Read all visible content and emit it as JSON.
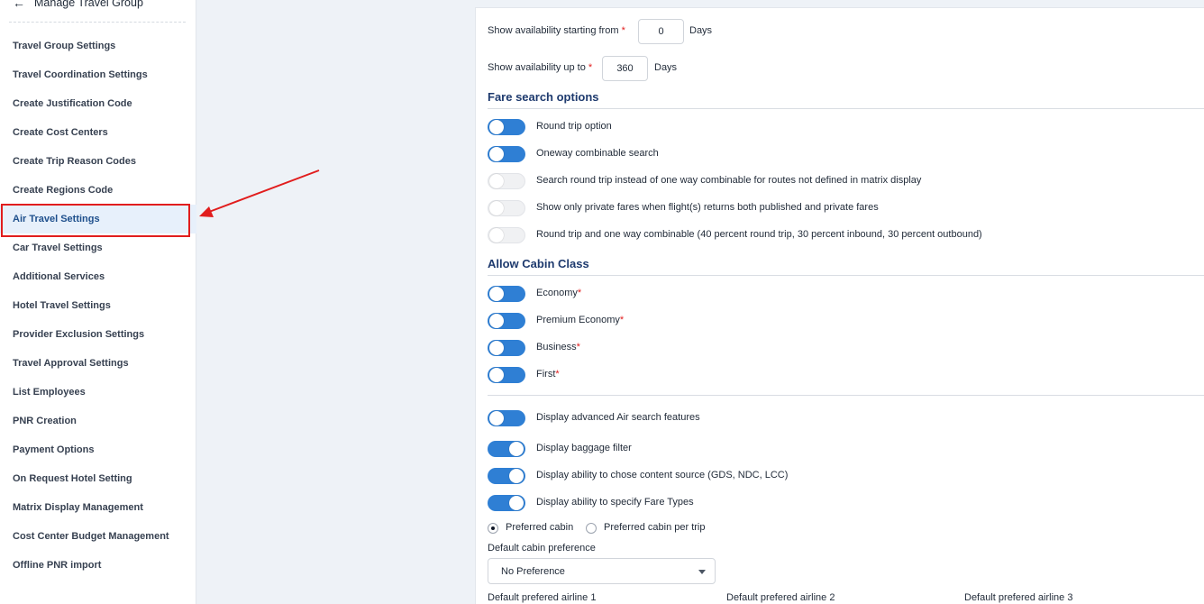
{
  "sidebar": {
    "title": "Manage Travel Group",
    "back_icon": "←",
    "items": [
      {
        "label": "Travel Group Settings"
      },
      {
        "label": "Travel Coordination Settings"
      },
      {
        "label": "Create Justification Code"
      },
      {
        "label": "Create Cost Centers"
      },
      {
        "label": "Create Trip Reason Codes"
      },
      {
        "label": "Create Regions Code"
      },
      {
        "label": "Air Travel Settings",
        "active": true
      },
      {
        "label": "Car Travel Settings"
      },
      {
        "label": "Additional Services"
      },
      {
        "label": "Hotel Travel Settings"
      },
      {
        "label": "Provider Exclusion Settings"
      },
      {
        "label": "Travel Approval Settings"
      },
      {
        "label": "List Employees"
      },
      {
        "label": "PNR Creation"
      },
      {
        "label": "Payment Options"
      },
      {
        "label": "On Request Hotel Setting"
      },
      {
        "label": "Matrix Display Management"
      },
      {
        "label": "Cost Center Budget Management"
      },
      {
        "label": "Offline PNR import"
      }
    ]
  },
  "availability": {
    "from_label": "Show availability starting from",
    "from_value": "0",
    "from_unit": "Days",
    "upto_label": "Show availability up to",
    "upto_value": "360",
    "upto_unit": "Days",
    "required_mark": "*"
  },
  "fare_search": {
    "title": "Fare search options",
    "options": [
      {
        "label": "Round trip option",
        "on": true
      },
      {
        "label": "Oneway combinable search",
        "on": true
      },
      {
        "label": "Search round trip instead of one way combinable for routes not defined in matrix display",
        "on": false
      },
      {
        "label": "Show only private fares when flight(s) returns both published and private fares",
        "on": false
      },
      {
        "label": "Round trip and one way combinable (40 percent round trip, 30 percent inbound, 30 percent outbound)",
        "on": false
      }
    ]
  },
  "cabin_class": {
    "title": "Allow Cabin Class",
    "required_mark": "*",
    "options": [
      {
        "label": "Economy",
        "on": true
      },
      {
        "label": "Premium Economy",
        "on": true
      },
      {
        "label": "Business",
        "on": true
      },
      {
        "label": "First",
        "on": true
      }
    ]
  },
  "advanced": {
    "options": [
      {
        "label": "Display advanced Air search features",
        "on": true
      },
      {
        "label": "Display baggage filter",
        "on": true
      },
      {
        "label": "Display ability to chose content source (GDS, NDC, LCC)",
        "on": true
      },
      {
        "label": "Display ability to specify Fare Types",
        "on": true
      }
    ]
  },
  "cabin_pref": {
    "radio_1": "Preferred cabin",
    "radio_2": "Preferred cabin per trip",
    "selected": "Preferred cabin",
    "default_label": "Default cabin preference",
    "default_value": "No Preference"
  },
  "airlines": {
    "label_1": "Default prefered airline 1",
    "label_2": "Default prefered airline 2",
    "label_3": "Default prefered airline 3"
  },
  "colors": {
    "accent": "#2f7fd4",
    "annotation": "#e11d1d",
    "active_bg": "#e7f0fb",
    "section_title": "#1e3a6e"
  }
}
